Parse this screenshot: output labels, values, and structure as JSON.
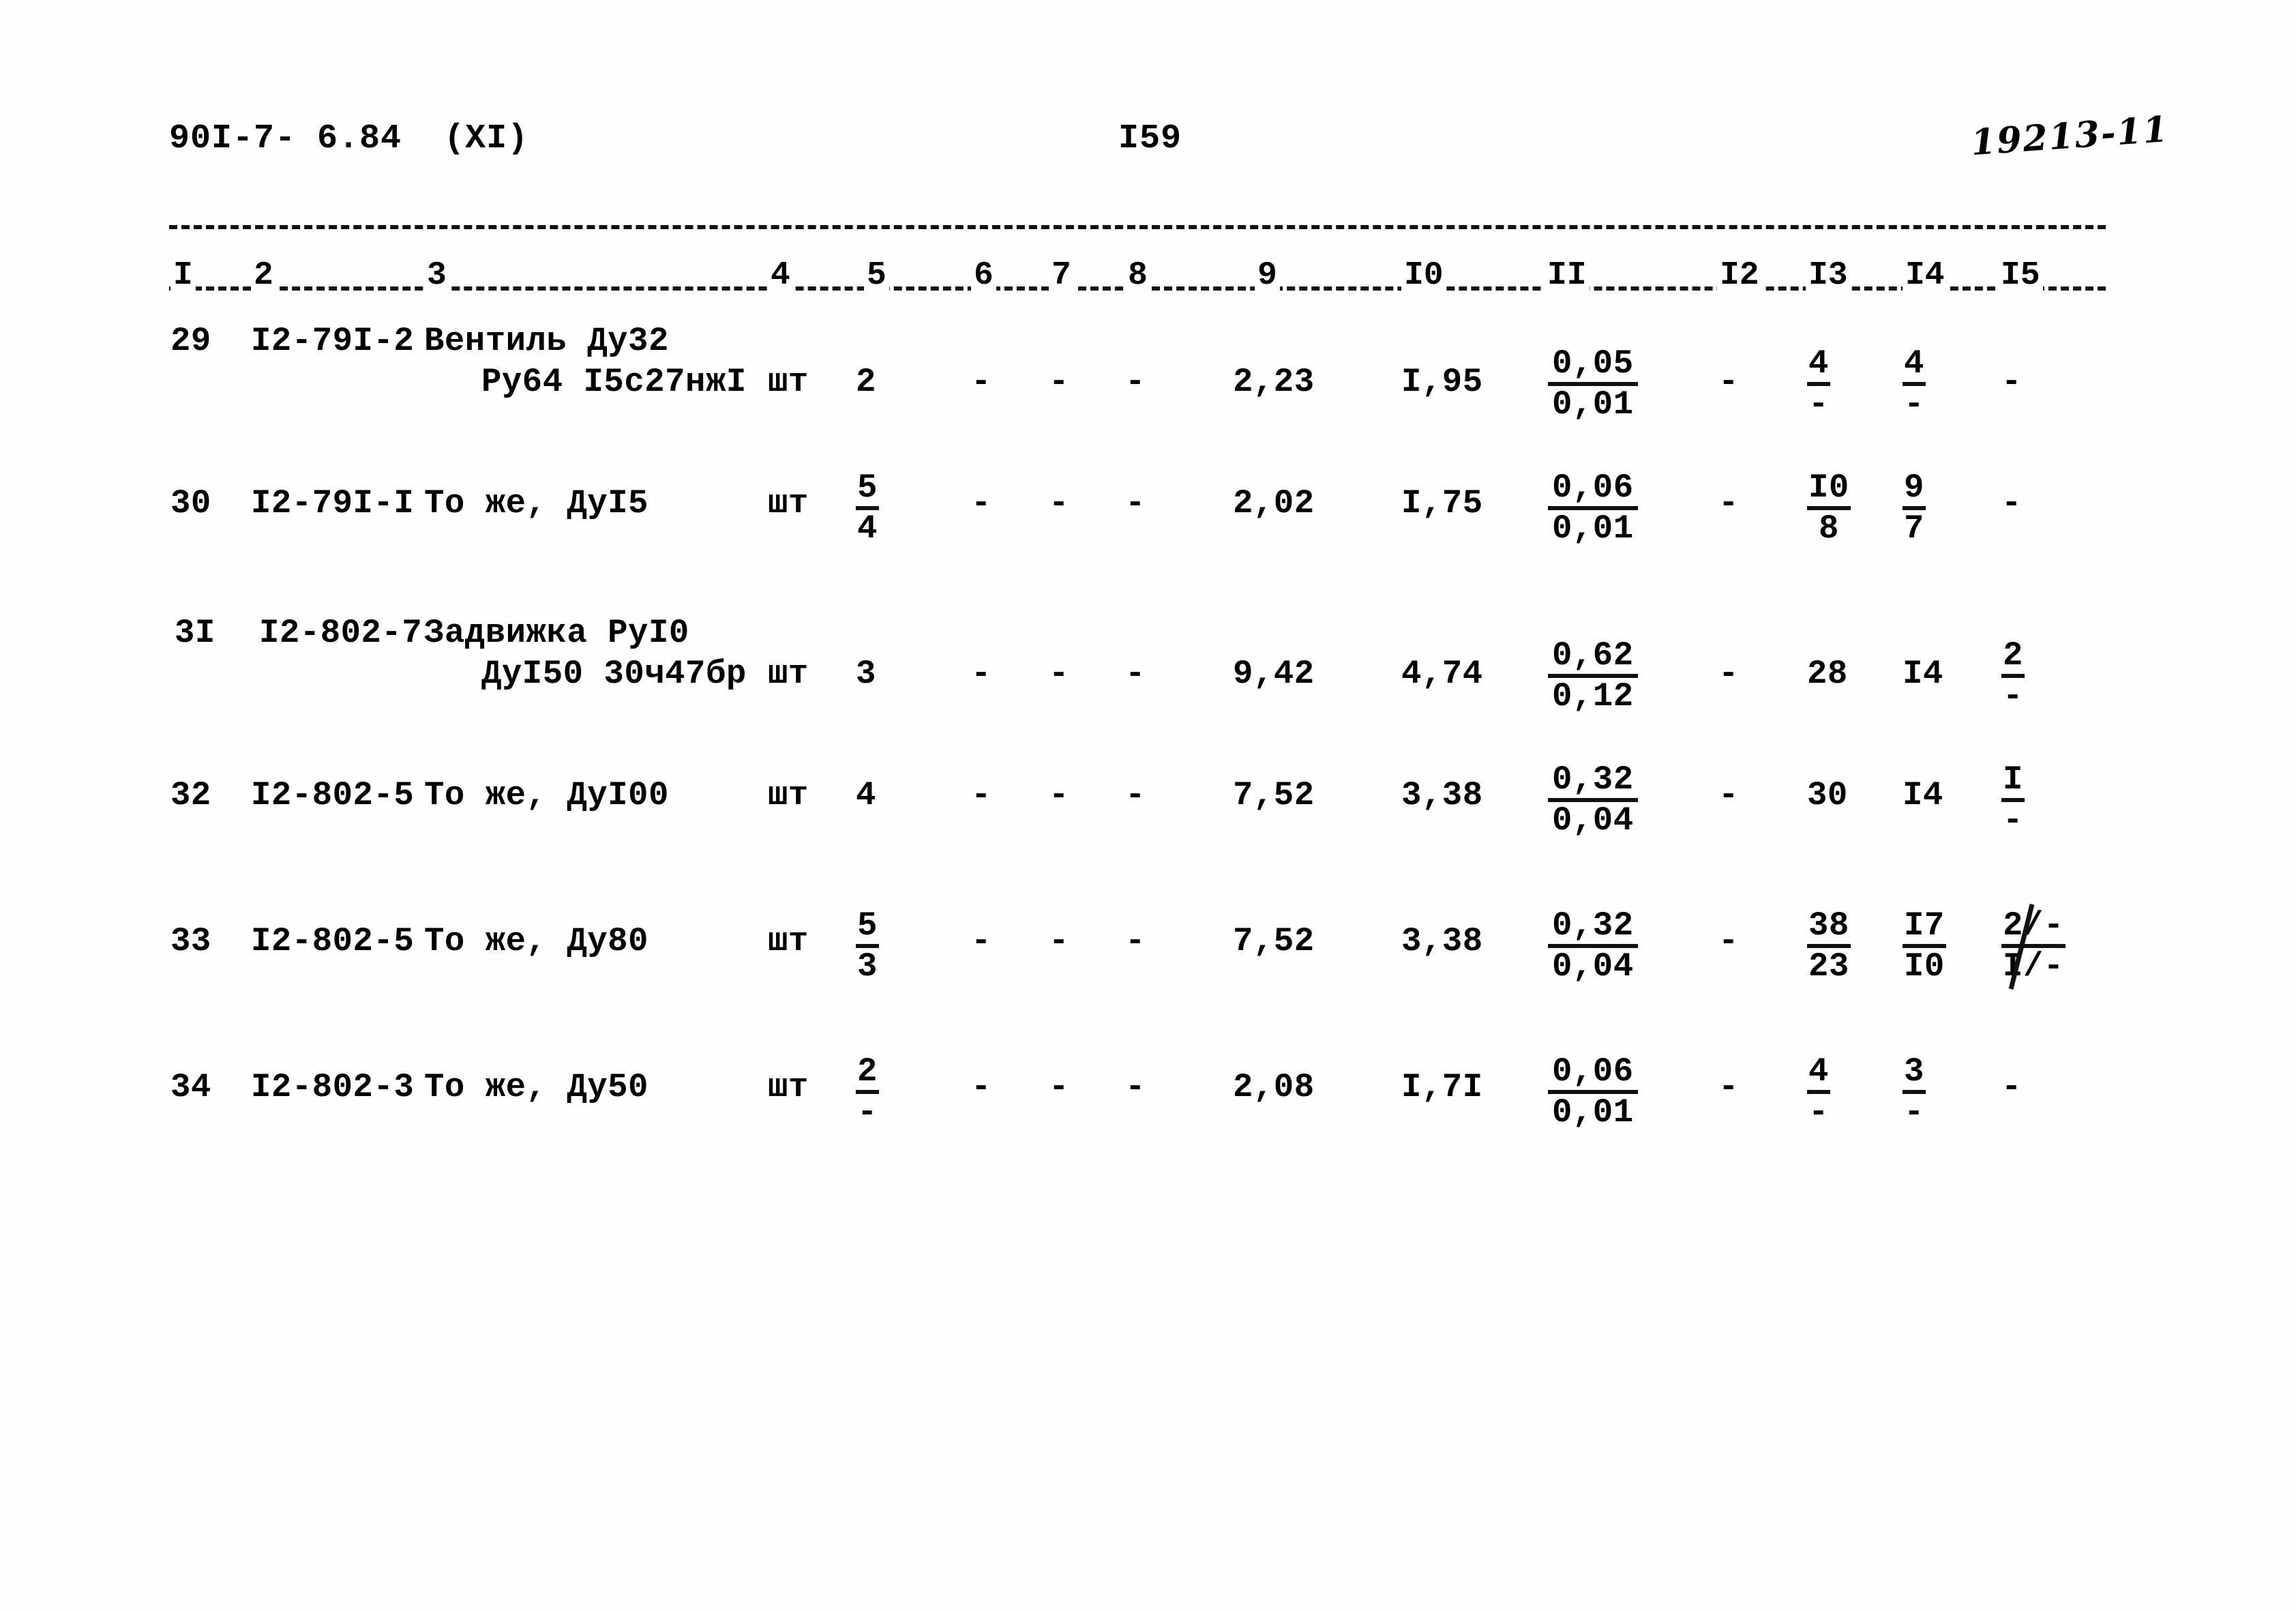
{
  "header": {
    "doc_code": "90I-7- 6.84  (XI)",
    "page_number": "I59",
    "handwritten_note": "19213-11"
  },
  "table": {
    "column_numbers": [
      "I",
      "2",
      "3",
      "4",
      "5",
      "6",
      "7",
      "8",
      "9",
      "I0",
      "II",
      "I2",
      "I3",
      "I4",
      "I5"
    ],
    "rows": [
      {
        "no": "29",
        "code": "I2-79I-2",
        "name_line1": "Вентиль Ду32",
        "name_line2": "Ру64 I5с27нжI",
        "unit": "шт",
        "qty": "2",
        "c6": "-",
        "c7": "-",
        "c8": "-",
        "c9": "2,23",
        "c10": "I,95",
        "c11_num": "0,05",
        "c11_den": "0,01",
        "c12": "-",
        "c13_num": "4",
        "c13_den": "-",
        "c14_num": "4",
        "c14_den": "-",
        "c15": "-"
      },
      {
        "no": "30",
        "code": "I2-79I-I",
        "name_line1": "То же, ДуI5",
        "name_line2": "",
        "unit": "шт",
        "qty_num": "5",
        "qty_den": "4",
        "c6": "-",
        "c7": "-",
        "c8": "-",
        "c9": "2,02",
        "c10": "I,75",
        "c11_num": "0,06",
        "c11_den": "0,01",
        "c12": "-",
        "c13_num": "I0",
        "c13_den": "8",
        "c14_num": "9",
        "c14_den": "7",
        "c15": "-"
      },
      {
        "no": "3I",
        "code": "I2-802-7",
        "name_line1": "Задвижка РуI0",
        "name_line2": "ДуI50 30ч47бр",
        "unit": "шт",
        "qty": "3",
        "c6": "-",
        "c7": "-",
        "c8": "-",
        "c9": "9,42",
        "c10": "4,74",
        "c11_num": "0,62",
        "c11_den": "0,12",
        "c12": "-",
        "c13": "28",
        "c14": "I4",
        "c15_num": "2",
        "c15_den": "-"
      },
      {
        "no": "32",
        "code": "I2-802-5",
        "name_line1": "То же, ДуI00",
        "name_line2": "",
        "unit": "шт",
        "qty": "4",
        "c6": "-",
        "c7": "-",
        "c8": "-",
        "c9": "7,52",
        "c10": "3,38",
        "c11_num": "0,32",
        "c11_den": "0,04",
        "c12": "-",
        "c13": "30",
        "c14": "I4",
        "c15_num": "I",
        "c15_den": "-"
      },
      {
        "no": "33",
        "code": "I2-802-5",
        "name_line1": "То же, Ду80",
        "name_line2": "",
        "unit": "шт",
        "qty_num": "5",
        "qty_den": "3",
        "c6": "-",
        "c7": "-",
        "c8": "-",
        "c9": "7,52",
        "c10": "3,38",
        "c11_num": "0,32",
        "c11_den": "0,04",
        "c12": "-",
        "c13_num": "38",
        "c13_den": "23",
        "c14_num": "I7",
        "c14_den": "I0",
        "c15_num": "2/-",
        "c15_den": "I/-"
      },
      {
        "no": "34",
        "code": "I2-802-3",
        "name_line1": "То же, Ду50",
        "name_line2": "",
        "unit": "шт",
        "qty_num": "2",
        "qty_den": "-",
        "c6": "-",
        "c7": "-",
        "c8": "-",
        "c9": "2,08",
        "c10": "I,7I",
        "c11_num": "0,06",
        "c11_den": "0,01",
        "c12": "-",
        "c13_num": "4",
        "c13_den": "-",
        "c14_num": "3",
        "c14_den": "-",
        "c15": "-"
      }
    ]
  }
}
